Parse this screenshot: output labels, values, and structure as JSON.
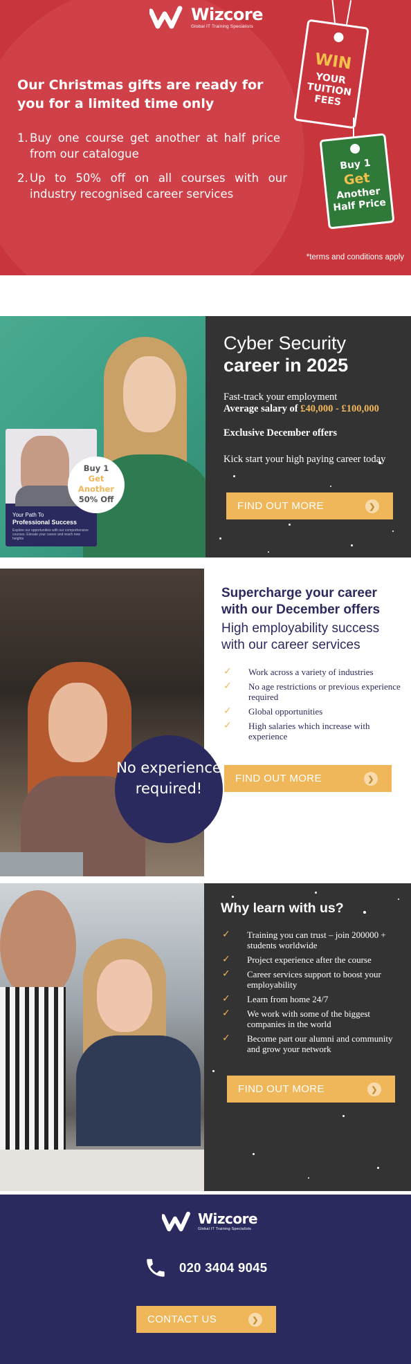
{
  "brand": {
    "name": "Wizcore",
    "tagline": "Global IT Training Specialists"
  },
  "hero": {
    "heading": "Our Christmas gifts are ready for you for a limited time only",
    "offers": [
      {
        "num": "1.",
        "text": "Buy one course get another at half price from our catalogue"
      },
      {
        "num": "2.",
        "text": "Up to 50% off on all courses with our industry recognised career services"
      }
    ],
    "terms": "*terms and conditions apply",
    "tag_win": {
      "line1": "WIN",
      "line2": "YOUR TUITION FEES"
    },
    "tag_buy": {
      "line1": "Buy 1",
      "line2": "Get",
      "line3": "Another Half Price"
    }
  },
  "section1": {
    "title_line1": "Cyber Security",
    "title_line2": "career in 2025",
    "fast_track": "Fast-track your employment",
    "salary_label": "Average salary of ",
    "salary_value": "£40,000 - £100,000",
    "exclusive": "Exclusive December offers",
    "kick": "Kick start your high paying career today",
    "button": "FIND OUT MORE",
    "book": {
      "line1": "Your Path To",
      "line2": "Professional Success",
      "line3": "Explore our opportunities with our comprehensive courses. Elevate your career and reach new heights"
    },
    "badge": {
      "line1": "Buy 1",
      "line2": "Get",
      "line3": "Another",
      "line4": "50% Off"
    }
  },
  "section2": {
    "heading": "Supercharge your career with our December offers",
    "subheading": "High employability success with our career services",
    "items": [
      "Work across a variety of industries",
      "No age restrictions or previous experience required",
      "Global opportunities",
      "High salaries which increase with experience"
    ],
    "circle": "No experience required!",
    "button": "FIND OUT MORE"
  },
  "section3": {
    "title": "Why learn with us?",
    "items": [
      "Training you can trust – join 200000 + students worldwide",
      "Project experience after the course",
      "Career services support to boost your employability",
      "Learn from home 24/7",
      "We work with some of the biggest companies in the world",
      "Become part our alumni and community and grow your network"
    ],
    "button": "FIND OUT MORE"
  },
  "footer": {
    "phone": "020 3404 9045",
    "button": "CONTACT US"
  },
  "icons": {
    "check": "check-icon",
    "arrow": "chevron-right-icon",
    "phone": "phone-icon"
  },
  "colors": {
    "red": "#c8353d",
    "navy": "#2b2a5e",
    "dark": "#333333",
    "gold": "#f0b65a",
    "green": "#2f7a39"
  }
}
